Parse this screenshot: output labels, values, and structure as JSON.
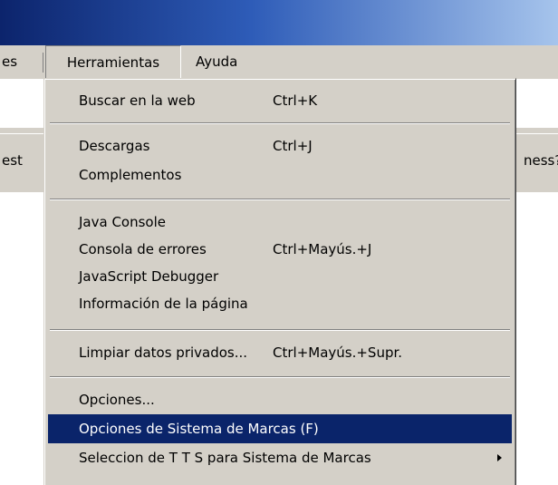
{
  "menubar": {
    "prev_label": "es",
    "tools_label": "Herramientas",
    "help_label": "Ayuda"
  },
  "toolbar": {
    "left_text": "est",
    "right_text": "ness?"
  },
  "menu": {
    "items": [
      {
        "label": "Buscar en la web",
        "shortcut": "Ctrl+K"
      },
      {
        "label": "Descargas",
        "shortcut": "Ctrl+J"
      },
      {
        "label": "Complementos",
        "shortcut": ""
      },
      {
        "label": "Java Console",
        "shortcut": ""
      },
      {
        "label": "Consola de errores",
        "shortcut": "Ctrl+Mayús.+J"
      },
      {
        "label": "JavaScript Debugger",
        "shortcut": ""
      },
      {
        "label": "Información de la página",
        "shortcut": ""
      },
      {
        "label": "Limpiar datos privados...",
        "shortcut": "Ctrl+Mayús.+Supr."
      },
      {
        "label": "Opciones...",
        "shortcut": ""
      },
      {
        "label": "Opciones de Sistema de Marcas (F)",
        "shortcut": ""
      },
      {
        "label": "Seleccion de T T S para Sistema de Marcas",
        "shortcut": ""
      }
    ]
  },
  "colors": {
    "highlight": "#0a246a",
    "menu_bg": "#d4d0c8"
  }
}
